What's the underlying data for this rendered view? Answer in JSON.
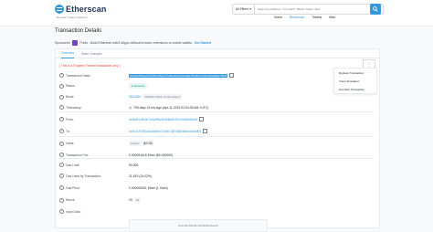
{
  "header": {
    "logo_text": "Etherscan",
    "network_label": "Ropsten Testnet Network",
    "search": {
      "filter_label": "All Filters",
      "placeholder": "Search by Address / Txn Hash / Block / Token / Ens"
    },
    "nav": [
      "Home",
      "Blockchain",
      "Tokens",
      "Misc"
    ],
    "active_nav": "Blockchain"
  },
  "page": {
    "title": "Transaction Details",
    "sponsored_label": "Sponsored:",
    "sponsor_text": "Portis - Build Ethereum web3 dApps without browser extensions or mobile wallets.",
    "sponsor_link": "Get Started"
  },
  "tabs": [
    "Overview",
    "State Changes"
  ],
  "tools_menu": [
    "Replace Transaction",
    "Trace Simulation",
    "Get Raw Transaction"
  ],
  "testnet_note": "[ This is a Ropsten Testnet transaction only ]",
  "rows": {
    "tx_hash": {
      "label": "Transaction Hash:",
      "value": "0x4d4c0f5e6a7d2c9f1e8b3a7c6d5e4f2a1b0c9d8e7f6a5b4c3d2e1f0a9b8c7d6e5"
    },
    "status": {
      "label": "Status:",
      "value": "Success"
    },
    "block": {
      "label": "Block:",
      "value": "5613360",
      "confirmations": "2018363 Block Confirmations"
    },
    "timestamp": {
      "label": "Timestamp:",
      "value": "795 days 15 hrs ago (Apr-11-2019 02:04:39 AM +UTC)"
    },
    "from": {
      "label": "From:",
      "value": "0x5a3f1c8e2b7d4a9f6c0e3b8d1a7f2c4e9b6d0a3f"
    },
    "to": {
      "label": "To:",
      "value": "0x4b11f7291cb3d4e0e714b5718f7a8f2a8cba4b4d02"
    },
    "value": {
      "label": "Value:",
      "amount": "0 Ether",
      "usd": "($0.00)"
    },
    "fee": {
      "label": "Transaction Fee:",
      "value": "0.000051619 Ether ($0.000000)"
    },
    "gas_limit": {
      "label": "Gas Limit:",
      "value": "90,000"
    },
    "gas_used": {
      "label": "Gas Used by Transaction:",
      "value": "21,619 (24.02%)"
    },
    "gas_price": {
      "label": "Gas Price:",
      "value": "0.000000001 Ether (1 Gwei)"
    },
    "nonce": {
      "label": "Nonce",
      "value": "15",
      "position": "69"
    },
    "input": {
      "label": "Input Data:",
      "value": "0x4c4f4c53b4b73e2fdd9b3ea22c"
    }
  }
}
